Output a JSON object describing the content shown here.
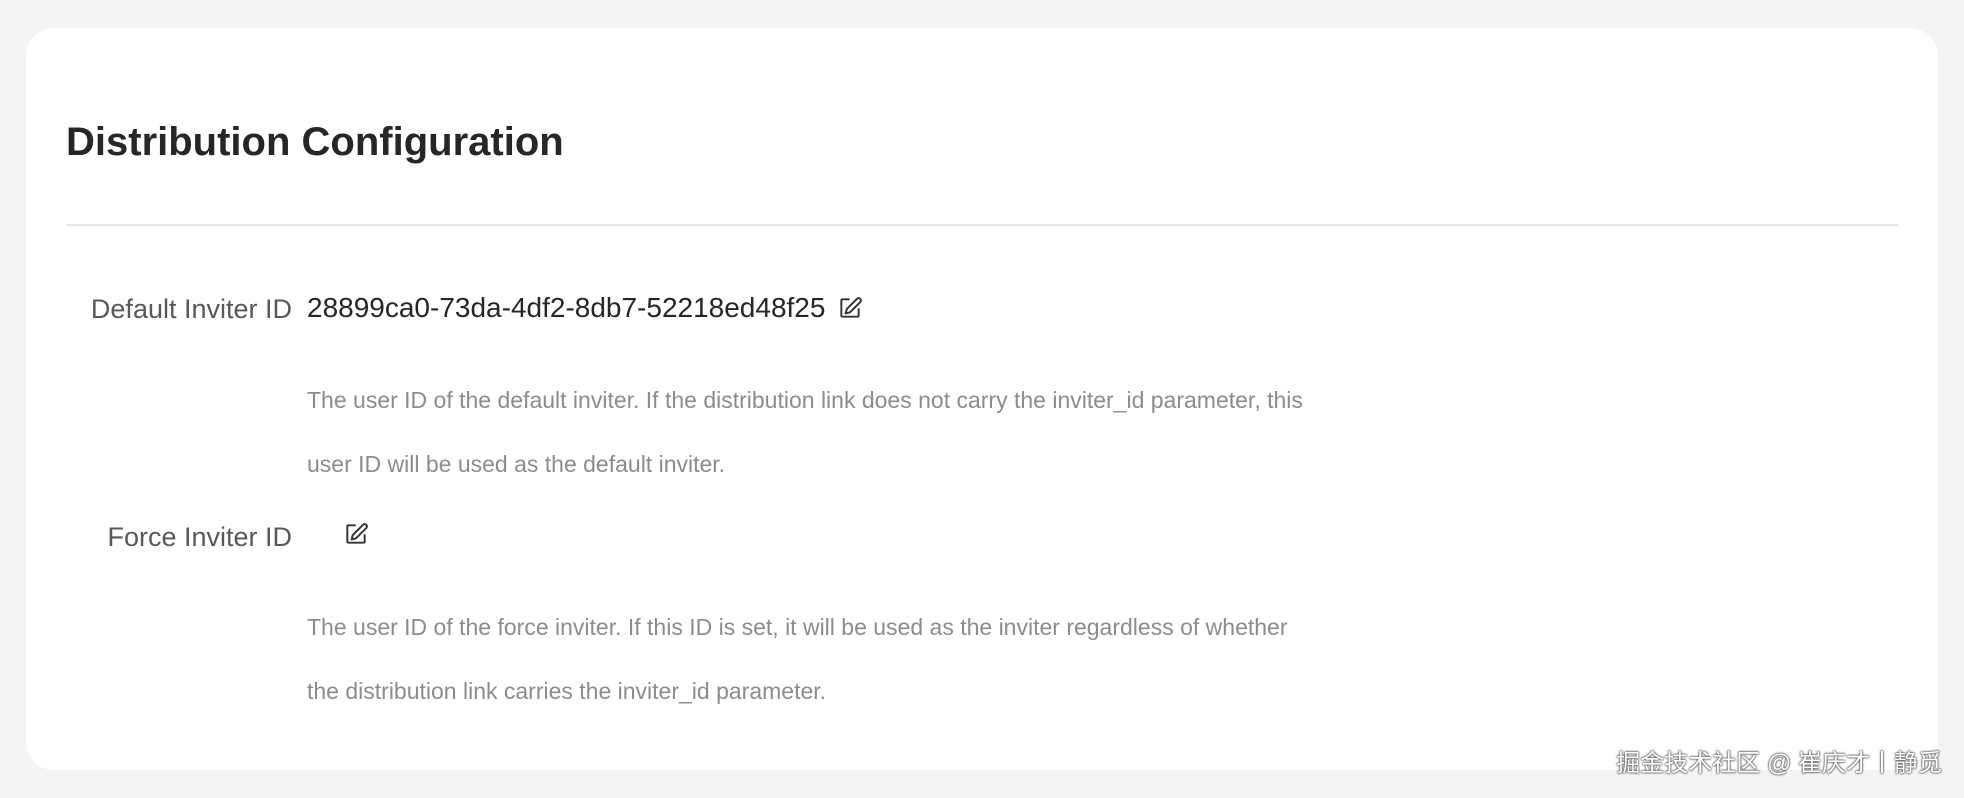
{
  "page": {
    "title": "Distribution Configuration"
  },
  "fields": [
    {
      "label": "Default Inviter ID",
      "value": "28899ca0-73da-4df2-8db7-52218ed48f25",
      "icon": "edit-icon",
      "help": "The user ID of the default inviter. If the distribution link does not carry the inviter_id parameter, this user ID will be used as the default inviter."
    },
    {
      "label": "Force Inviter ID",
      "value": "",
      "icon": "edit-icon",
      "help": "The user ID of the force inviter. If this ID is set, it will be used as the inviter regardless of whether the distribution link carries the inviter_id parameter."
    }
  ],
  "watermark": "掘金技术社区 @ 崔庆才丨静觅",
  "colors": {
    "background": "#f3f4f6",
    "card": "#ffffff",
    "title": "#262626",
    "label": "#595959",
    "help": "#8c8c8c"
  }
}
